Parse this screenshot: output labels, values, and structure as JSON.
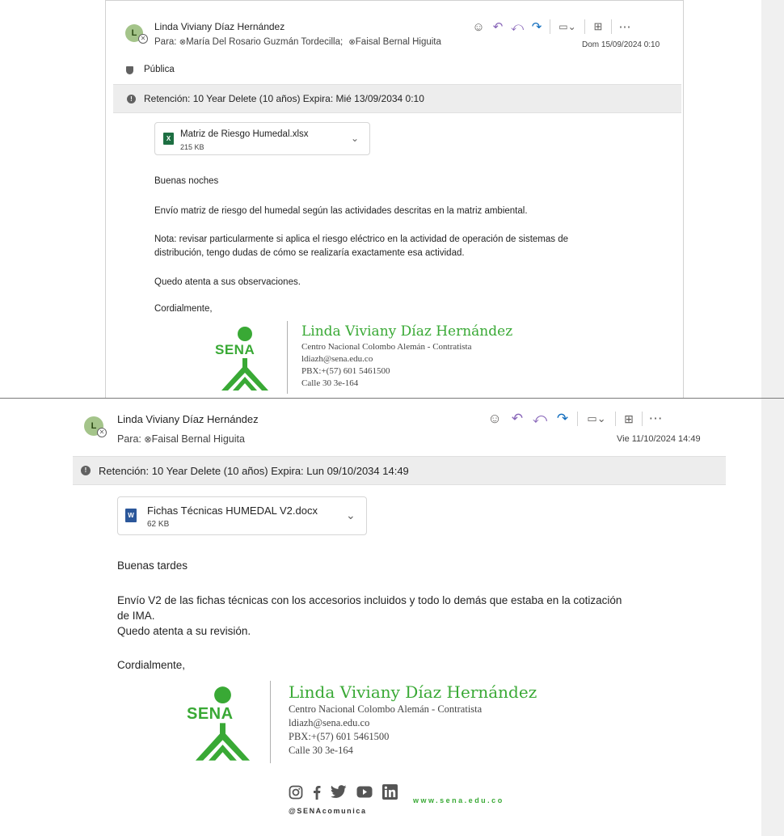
{
  "email1": {
    "avatar_initial": "L",
    "sender": "Linda Viviany Díaz Hernández",
    "to_label": "Para:",
    "recipients": [
      "María Del Rosario Guzmán Tordecilla;",
      "Faisal Bernal Higuita"
    ],
    "date": "Dom 15/09/2024 0:10",
    "sensitivity": "Pública",
    "retention": "Retención: 10 Year Delete (10 años) Expira: Mié 13/09/2034 0:10",
    "attachment": {
      "name": "Matriz de Riesgo Humedal.xlsx",
      "size": "215 KB",
      "icon": "excel-icon"
    },
    "body": {
      "greeting": "Buenas noches",
      "p1": "Envío matriz de riesgo del humedal según las actividades descritas en la matriz ambiental.",
      "p2a": "Nota: revisar particularmente si aplica el riesgo eléctrico en la actividad de operación de sistemas de",
      "p2b": "distribución, tengo dudas de cómo se realizaría exactamente esa actividad.",
      "p3": "Quedo atenta a sus observaciones.",
      "closing": "Cordialmente,"
    },
    "signature": {
      "logo_text": "SENA",
      "name": "Linda Viviany Díaz Hernández",
      "org": "Centro Nacional Colombo Alemán - Contratista",
      "email": "ldiazh@sena.edu.co",
      "phone": "PBX:+(57) 601 5461500",
      "address": "Calle 30 3e-164"
    }
  },
  "email2": {
    "avatar_initial": "L",
    "sender": "Linda Viviany Díaz Hernández",
    "to_label": "Para:",
    "recipients": [
      "Faisal Bernal Higuita"
    ],
    "date": "Vie 11/10/2024 14:49",
    "retention": "Retención: 10 Year Delete (10 años) Expira: Lun 09/10/2034 14:49",
    "attachment": {
      "name": "Fichas Técnicas HUMEDAL V2.docx",
      "size": "62 KB",
      "icon": "word-icon"
    },
    "body": {
      "greeting": "Buenas tardes",
      "p1a": "Envío V2 de las fichas técnicas con los accesorios incluidos y todo lo demás que estaba en la cotización",
      "p1b": "de IMA.",
      "p1c": "Quedo atenta a su revisión.",
      "closing": "Cordialmente,"
    },
    "signature": {
      "logo_text": "SENA",
      "name": "Linda Viviany Díaz Hernández",
      "org": "Centro Nacional Colombo Alemán - Contratista",
      "email": "ldiazh@sena.edu.co",
      "phone": "PBX:+(57) 601 5461500",
      "address": "Calle 30 3e-164",
      "website": "www.sena.edu.co",
      "handle": "@SENAcomunica",
      "social_icons": [
        "instagram-icon",
        "facebook-icon",
        "twitter-icon",
        "youtube-icon",
        "linkedin-icon"
      ]
    }
  },
  "colors": {
    "sena_green": "#39a935",
    "retention_bg": "#ededed",
    "accent_blue": "#0f6cbd"
  }
}
